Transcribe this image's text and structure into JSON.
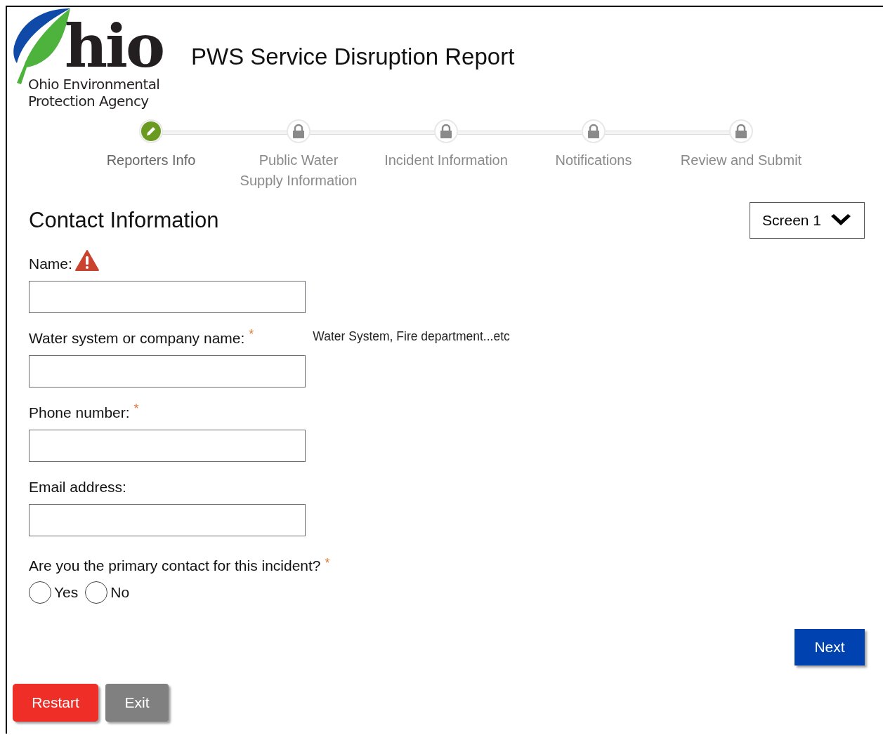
{
  "logo": {
    "mark": "hio",
    "agency_line_1": "Ohio Environmental",
    "agency_line_2": "Protection Agency"
  },
  "title": "PWS Service Disruption Report",
  "steps": [
    {
      "label": "Reporters Info",
      "selected": true,
      "locked": false
    },
    {
      "label": "Public Water Supply Information",
      "selected": false,
      "locked": true
    },
    {
      "label": "Incident Information",
      "selected": false,
      "locked": true
    },
    {
      "label": "Notifications",
      "selected": false,
      "locked": true
    },
    {
      "label": "Review and Submit",
      "selected": false,
      "locked": true
    }
  ],
  "section_title": "Contact Information",
  "screen_select": {
    "value": "Screen 1"
  },
  "fields": [
    {
      "label": "Name:",
      "required": false,
      "error": true
    },
    {
      "label": "Water system or company name:",
      "required": true,
      "error": false,
      "hint": "Water System, Fire department...etc"
    },
    {
      "label": "Phone number:",
      "required": true,
      "error": false
    },
    {
      "label": "Email address:",
      "required": false,
      "error": false
    }
  ],
  "question": {
    "label": "Are you the primary contact for this incident?",
    "required": true,
    "options": [
      {
        "label": "Yes",
        "selected": false
      },
      {
        "label": "No",
        "selected": false
      }
    ]
  },
  "required_mark": "*",
  "buttons": {
    "next": "Next",
    "restart": "Restart",
    "exit": "Exit"
  }
}
